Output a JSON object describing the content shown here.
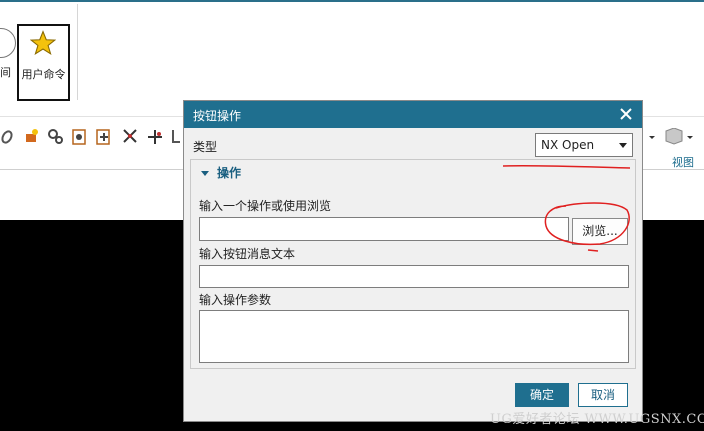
{
  "ribbon": {
    "partial_label": "间",
    "user_command_label": "用户命令",
    "view_label": "视图"
  },
  "dialog": {
    "title": "按钮操作",
    "type_label": "类型",
    "type_value": "NX Open",
    "group_title": "操作",
    "action_label": "输入一个操作或使用浏览",
    "action_value": "",
    "browse_label": "浏览...",
    "message_label": "输入按钮消息文本",
    "message_value": "",
    "params_label": "输入操作参数",
    "params_value": "",
    "ok_label": "确定",
    "cancel_label": "取消"
  },
  "watermark": "UG爱好者论坛 WWW.UGSNX.COM",
  "colors": {
    "titlebar": "#1f6f8f",
    "annotation": "#e02020"
  }
}
